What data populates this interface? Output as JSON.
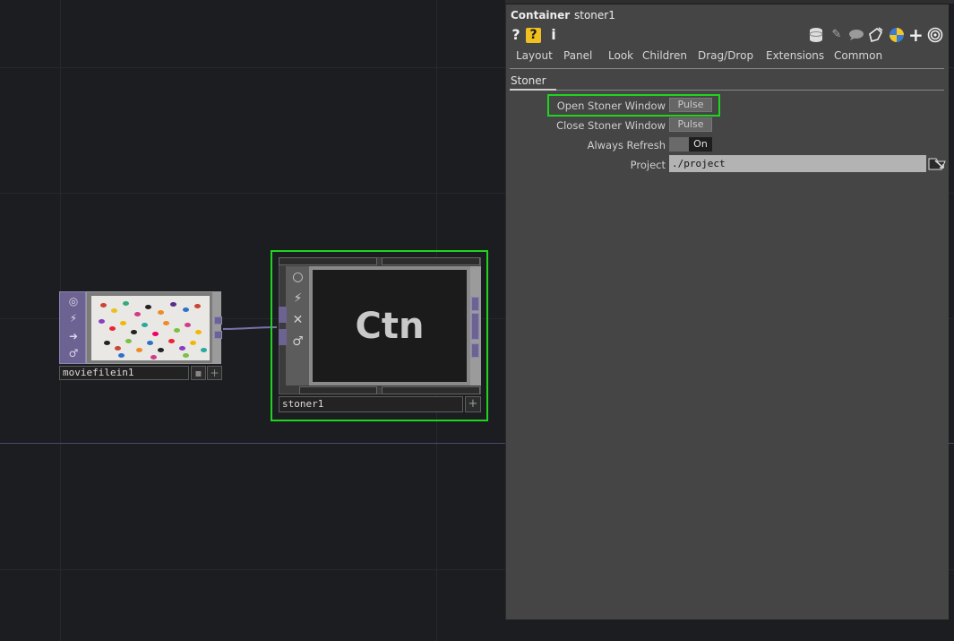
{
  "panel": {
    "type_label": "Container",
    "op_name": "stoner1",
    "tabs": [
      "Layout",
      "Panel",
      "Look",
      "Children",
      "Drag/Drop",
      "Extensions",
      "Common"
    ],
    "active_page": "Stoner",
    "params": [
      {
        "label": "Open Stoner Window",
        "kind": "pulse",
        "value": "Pulse",
        "highlighted": true
      },
      {
        "label": "Close Stoner Window",
        "kind": "pulse",
        "value": "Pulse"
      },
      {
        "label": "Always Refresh",
        "kind": "toggle",
        "value": "On"
      },
      {
        "label": "Project",
        "kind": "text",
        "value": "./project"
      }
    ],
    "toolbar_left_icons": [
      "help-icon",
      "op-help-icon",
      "info-icon"
    ],
    "toolbar_right_icons": [
      "database-icon",
      "pencil-icon",
      "comment-icon",
      "clone-icon",
      "python-icon",
      "add-icon",
      "target-icon"
    ]
  },
  "network": {
    "movie_node": {
      "name": "moviefilein1"
    },
    "container_node": {
      "name": "stoner1",
      "viewer_text": "Ctn"
    }
  },
  "colors": {
    "selection_highlight": "#1fd41f",
    "node_purple": "#6d6393",
    "panel_bg": "#454545",
    "network_bg": "#1c1d21"
  }
}
